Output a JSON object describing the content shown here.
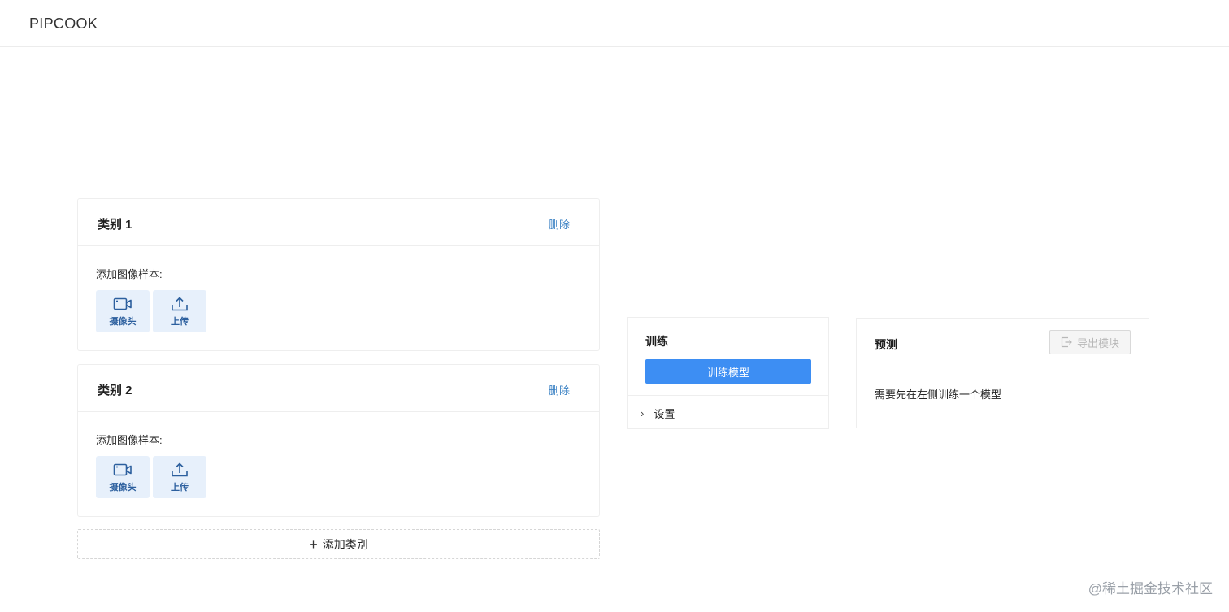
{
  "header": {
    "app_title": "PIPCOOK"
  },
  "categories": [
    {
      "title": "类别 1",
      "delete_label": "删除",
      "sample_label": "添加图像样本:",
      "camera_label": "摄像头",
      "upload_label": "上传"
    },
    {
      "title": "类别 2",
      "delete_label": "删除",
      "sample_label": "添加图像样本:",
      "camera_label": "摄像头",
      "upload_label": "上传"
    }
  ],
  "add_category": {
    "icon": "plus-icon",
    "label": "添加类别"
  },
  "train": {
    "title": "训练",
    "button_label": "训练模型",
    "settings_label": "设置",
    "accent_color": "#3d8ef3"
  },
  "predict": {
    "title": "预测",
    "export_label": "导出模块",
    "hint": "需要先在左侧训练一个模型"
  },
  "watermark": "@稀土掘金技术社区"
}
